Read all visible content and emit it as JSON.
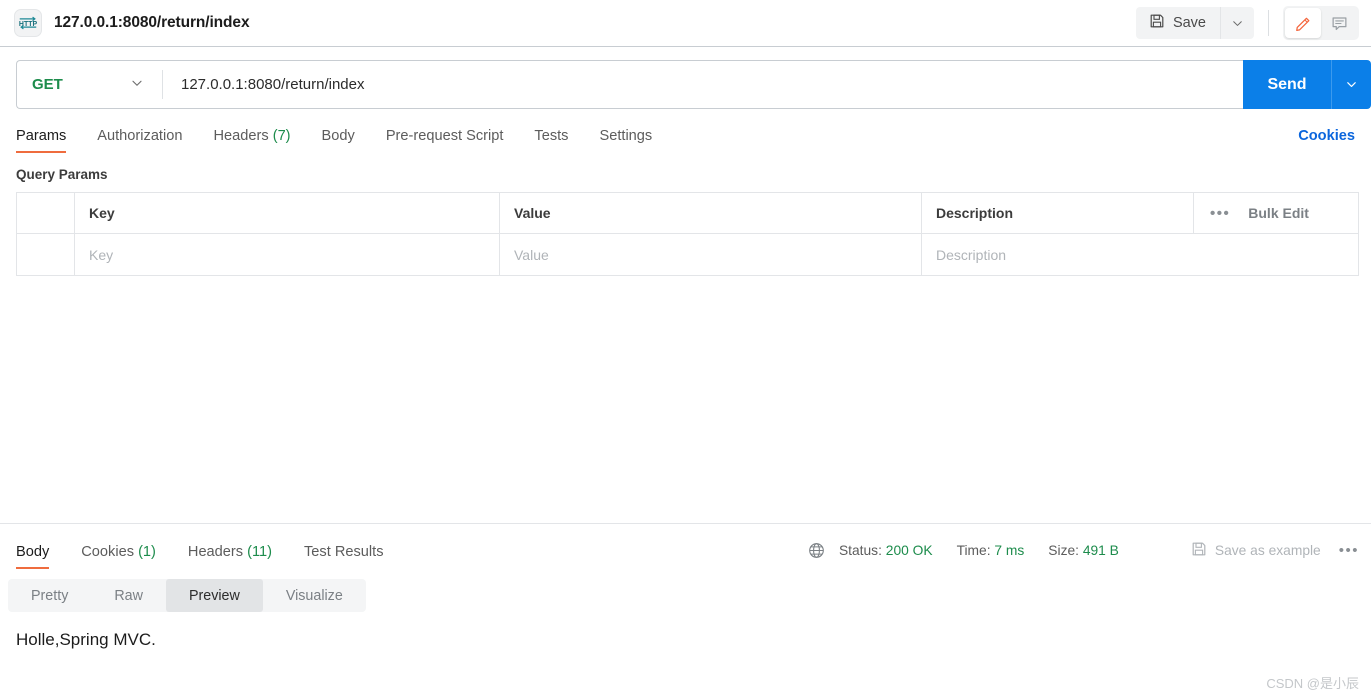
{
  "window": {
    "tab_title": "127.0.0.1:8080/return/index",
    "protocol_icon": "http-icon"
  },
  "toolbar": {
    "save_label": "Save",
    "save_caret_icon": "chevron-down-icon",
    "edit_icon": "pencil-icon",
    "comment_icon": "comment-icon"
  },
  "request": {
    "method": "GET",
    "method_caret_icon": "chevron-down-icon",
    "url": "127.0.0.1:8080/return/index",
    "send_label": "Send",
    "send_caret_icon": "chevron-down-icon"
  },
  "request_tabs": [
    {
      "label": "Params",
      "count": "",
      "active": true
    },
    {
      "label": "Authorization",
      "count": "",
      "active": false
    },
    {
      "label": "Headers",
      "count": "(7)",
      "active": false
    },
    {
      "label": "Body",
      "count": "",
      "active": false
    },
    {
      "label": "Pre-request Script",
      "count": "",
      "active": false
    },
    {
      "label": "Tests",
      "count": "",
      "active": false
    },
    {
      "label": "Settings",
      "count": "",
      "active": false
    }
  ],
  "cookies_link": "Cookies",
  "query_params": {
    "section_label": "Query Params",
    "columns": [
      "Key",
      "Value",
      "Description"
    ],
    "row_placeholders": [
      "Key",
      "Value",
      "Description"
    ],
    "more_icon": "ellipsis-icon",
    "bulk_edit_label": "Bulk Edit"
  },
  "response_tabs": [
    {
      "label": "Body",
      "count": "",
      "active": true
    },
    {
      "label": "Cookies",
      "count": "(1)",
      "active": false
    },
    {
      "label": "Headers",
      "count": "(11)",
      "active": false
    },
    {
      "label": "Test Results",
      "count": "",
      "active": false
    }
  ],
  "response_status": {
    "globe_icon": "globe-icon",
    "status_label": "Status:",
    "status_value": "200 OK",
    "time_label": "Time:",
    "time_value": "7 ms",
    "size_label": "Size:",
    "size_value": "491 B",
    "save_example_icon": "save-icon",
    "save_example_label": "Save as example",
    "more_icon": "ellipsis-icon"
  },
  "view_switch": [
    {
      "label": "Pretty",
      "active": false
    },
    {
      "label": "Raw",
      "active": false
    },
    {
      "label": "Preview",
      "active": true
    },
    {
      "label": "Visualize",
      "active": false
    }
  ],
  "response_body": "Holle,Spring MVC.",
  "watermark": "CSDN @是小辰",
  "colors": {
    "accent_orange": "#ef6c3e",
    "send_blue": "#0b7fe8",
    "link_blue": "#0b66dd",
    "status_green": "#1d8c4c",
    "border": "#e3e5e8"
  }
}
